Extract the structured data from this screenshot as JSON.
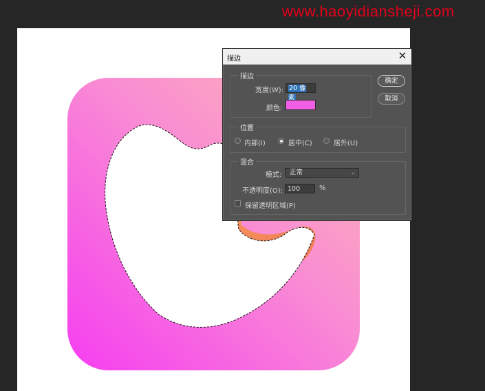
{
  "watermark": "www.haoyidiansheji.com",
  "stroke_dialog": {
    "title": "描边",
    "close_glyph": "✕",
    "stroke_section": {
      "label": "描边",
      "width_label": "宽度(W):",
      "width_value": "20 像素",
      "color_label": "颜色:",
      "color_value": "#f25fe4"
    },
    "position_section": {
      "label": "位置",
      "options": [
        {
          "label": "内部(I)",
          "checked": false
        },
        {
          "label": "居中(C)",
          "checked": true
        },
        {
          "label": "居外(U)",
          "checked": false
        }
      ]
    },
    "blend_section": {
      "label": "混合",
      "mode_label": "模式:",
      "mode_value": "正常",
      "opacity_label": "不透明度(O):",
      "opacity_value": "100",
      "opacity_unit": "%",
      "preserve_label": "保留透明区域(P)",
      "preserve_checked": false
    },
    "ok_label": "确定",
    "cancel_label": "取消"
  },
  "canvas": {
    "icon_gradient": [
      "#f53df0",
      "#f98bd4",
      "#fbb3b8"
    ],
    "accent_orange": "#f4884a"
  }
}
